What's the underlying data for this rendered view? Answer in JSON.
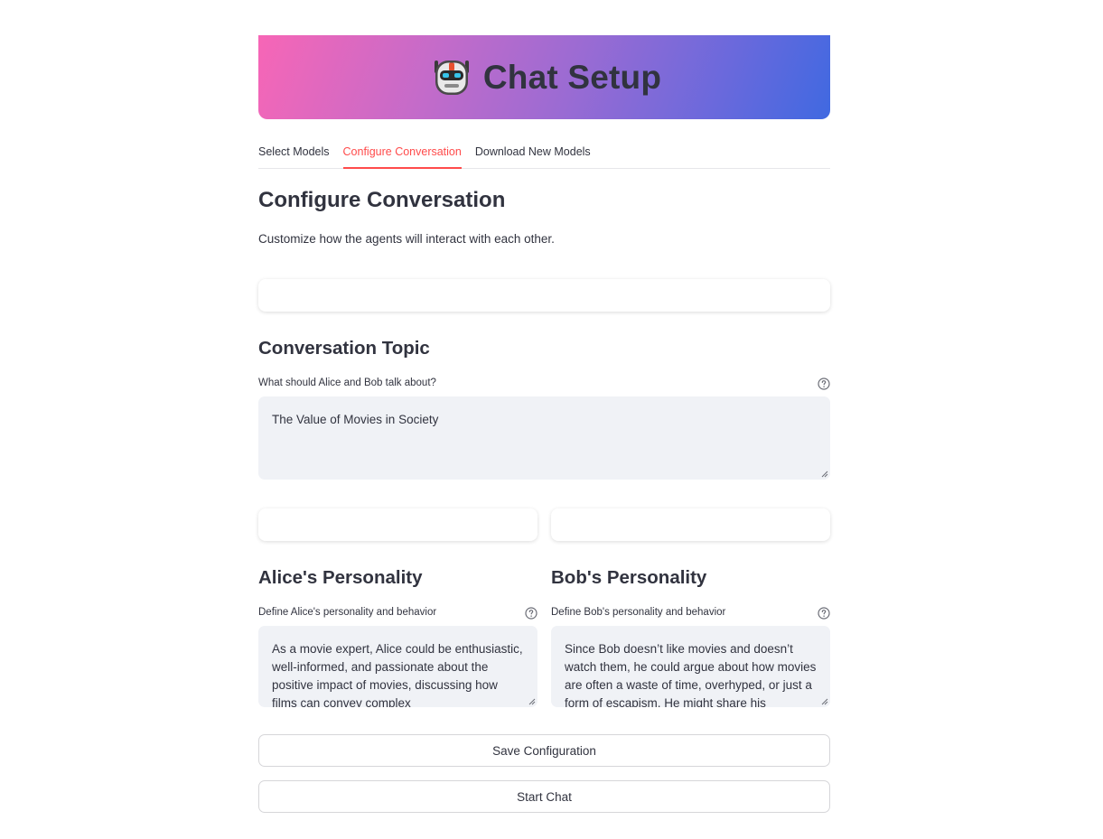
{
  "header": {
    "title": "Chat Setup",
    "icon": "robot-icon"
  },
  "tabs": [
    {
      "label": "Select Models",
      "active": false
    },
    {
      "label": "Configure Conversation",
      "active": true
    },
    {
      "label": "Download New Models",
      "active": false
    }
  ],
  "section": {
    "title": "Configure Conversation",
    "description": "Customize how the agents will interact with each other."
  },
  "topic": {
    "title": "Conversation Topic",
    "label": "What should Alice and Bob talk about?",
    "value": "The Value of Movies in Society"
  },
  "alice": {
    "title": "Alice's Personality",
    "label": "Define Alice's personality and behavior",
    "value": "As a movie expert, Alice could be enthusiastic, well-informed, and passionate about the positive impact of movies, discussing how films can convey complex"
  },
  "bob": {
    "title": "Bob's Personality",
    "label": "Define Bob's personality and behavior",
    "value": "Since Bob doesn’t like movies and doesn’t watch them, he could argue about how movies are often a waste of time, overhyped, or just a form of escapism. He might share his"
  },
  "buttons": {
    "save": "Save Configuration",
    "start": "Start Chat"
  },
  "colors": {
    "accent": "#ff4b4b",
    "banner_start": "#f766b6",
    "banner_end": "#4069e1",
    "input_bg": "#f0f2f6"
  }
}
